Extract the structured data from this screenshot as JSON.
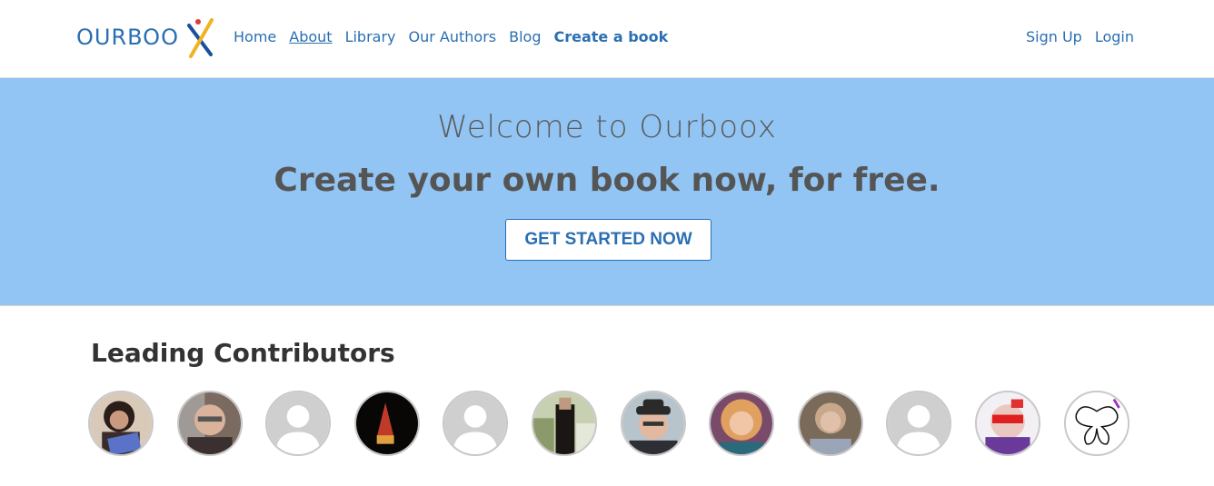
{
  "brand": {
    "logo_text": "OURBOOX"
  },
  "nav": {
    "items": [
      {
        "label": "Home"
      },
      {
        "label": "About"
      },
      {
        "label": "Library"
      },
      {
        "label": "Our Authors"
      },
      {
        "label": "Blog"
      },
      {
        "label": "Create a book"
      }
    ]
  },
  "auth": {
    "signup_label": "Sign Up",
    "login_label": "Login"
  },
  "hero": {
    "title": "Welcome to Ourboox",
    "subtitle": "Create your own book now, for free.",
    "cta_label": "GET STARTED NOW",
    "background_color": "#92c5f3"
  },
  "contributors": {
    "heading": "Leading Contributors",
    "avatars": [
      {
        "icon": "user-photo-icon"
      },
      {
        "icon": "user-photo-icon"
      },
      {
        "icon": "default-avatar-icon"
      },
      {
        "icon": "user-photo-icon"
      },
      {
        "icon": "default-avatar-icon"
      },
      {
        "icon": "user-photo-icon"
      },
      {
        "icon": "user-photo-icon"
      },
      {
        "icon": "user-photo-icon"
      },
      {
        "icon": "user-photo-icon"
      },
      {
        "icon": "default-avatar-icon"
      },
      {
        "icon": "user-photo-icon"
      },
      {
        "icon": "butterfly-drawing-icon"
      }
    ]
  },
  "colors": {
    "link": "#2a6fb3",
    "text_dark": "#555555"
  }
}
